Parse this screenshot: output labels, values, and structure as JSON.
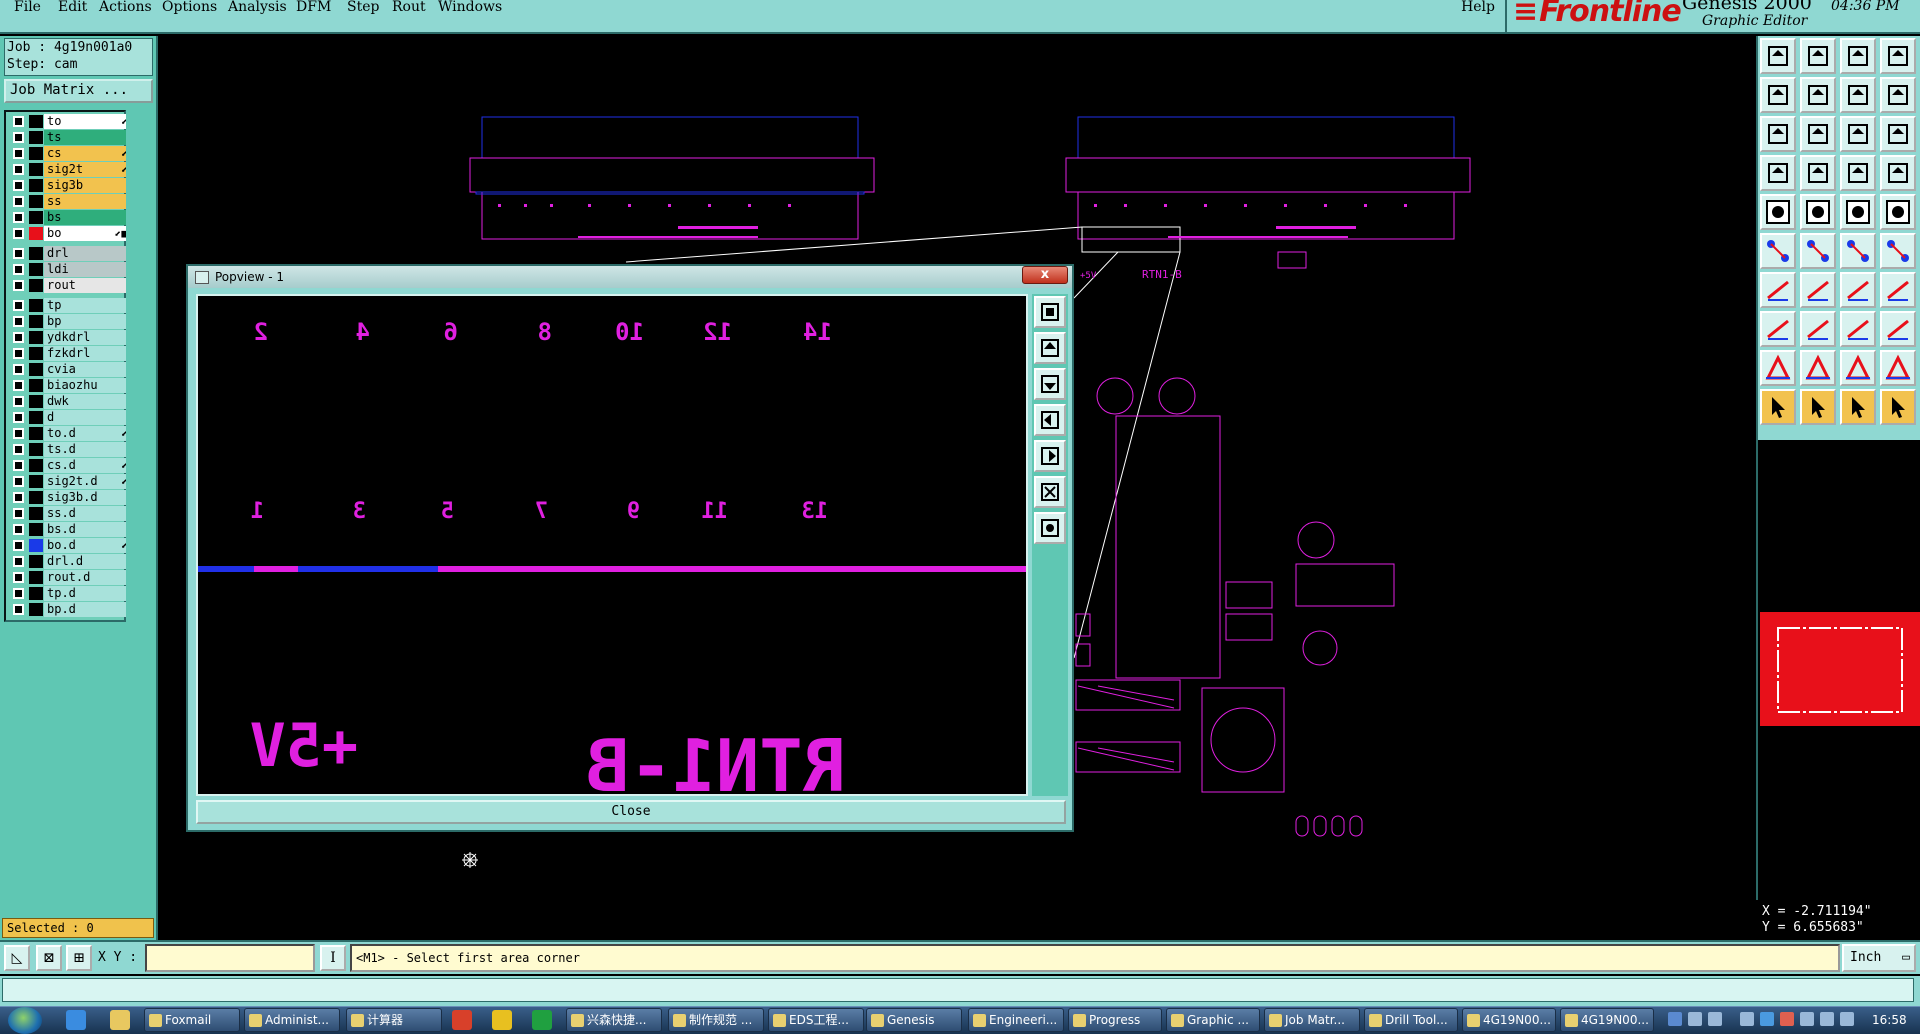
{
  "menu": {
    "items": [
      "File",
      "Edit",
      "Actions",
      "Options",
      "Analysis",
      "DFM",
      "Step",
      "Rout",
      "Windows"
    ],
    "help": "Help"
  },
  "brand": {
    "logo": "Frontline",
    "product": "Genesis 2000",
    "subtitle": "Graphic Editor",
    "time": "04:36 PM"
  },
  "job": {
    "job_line": "Job : 4g19n001a0",
    "step_line": "Step: cam",
    "matrix_button": "Job Matrix ..."
  },
  "layers": [
    {
      "name": "to",
      "color": "#ffffff",
      "marker": "⬋"
    },
    {
      "name": "ts",
      "color": "#2fae7c",
      "marker": ""
    },
    {
      "name": "cs",
      "color": "#f2c24e",
      "marker": "⬋"
    },
    {
      "name": "sig2t",
      "color": "#f2c24e",
      "marker": "⬋"
    },
    {
      "name": "sig3b",
      "color": "#f2c24e",
      "marker": ""
    },
    {
      "name": "ss",
      "color": "#f2c24e",
      "marker": ""
    },
    {
      "name": "bs",
      "color": "#2fae7c",
      "marker": ""
    },
    {
      "name": "bo",
      "color": "#ffffff",
      "marker": "⬋■",
      "swatch": "#e8101a"
    },
    {
      "name": "drl",
      "color": "#b8c8c8",
      "marker": ""
    },
    {
      "name": "ldi",
      "color": "#b8c8c8",
      "marker": ""
    },
    {
      "name": "rout",
      "color": "#e6e6e6",
      "marker": ""
    },
    {
      "name": "tp",
      "color": "#a8e2db",
      "marker": ""
    },
    {
      "name": "bp",
      "color": "#a8e2db",
      "marker": ""
    },
    {
      "name": "ydkdrl",
      "color": "#a8e2db",
      "marker": ""
    },
    {
      "name": "fzkdrl",
      "color": "#a8e2db",
      "marker": ""
    },
    {
      "name": "cvia",
      "color": "#a8e2db",
      "marker": ""
    },
    {
      "name": "biaozhu",
      "color": "#a8e2db",
      "marker": ""
    },
    {
      "name": "dwk",
      "color": "#a8e2db",
      "marker": ""
    },
    {
      "name": "d",
      "color": "#a8e2db",
      "marker": ""
    },
    {
      "name": "to.d",
      "color": "#a8e2db",
      "marker": "⬋"
    },
    {
      "name": "ts.d",
      "color": "#a8e2db",
      "marker": ""
    },
    {
      "name": "cs.d",
      "color": "#a8e2db",
      "marker": "⬋"
    },
    {
      "name": "sig2t.d",
      "color": "#a8e2db",
      "marker": "⬋"
    },
    {
      "name": "sig3b.d",
      "color": "#a8e2db",
      "marker": ""
    },
    {
      "name": "ss.d",
      "color": "#a8e2db",
      "marker": ""
    },
    {
      "name": "bs.d",
      "color": "#a8e2db",
      "marker": ""
    },
    {
      "name": "bo.d",
      "color": "#a8e2db",
      "marker": "⬋",
      "swatch": "#1a3ae8"
    },
    {
      "name": "drl.d",
      "color": "#a8e2db",
      "marker": ""
    },
    {
      "name": "rout.d",
      "color": "#a8e2db",
      "marker": ""
    },
    {
      "name": "tp.d",
      "color": "#a8e2db",
      "marker": ""
    },
    {
      "name": "bp.d",
      "color": "#a8e2db",
      "marker": ""
    }
  ],
  "selected": "Selected : 0",
  "coords": {
    "x": "X = -2.711194\"",
    "y": "Y = 6.655683\""
  },
  "command": {
    "xy_label": "X Y :",
    "xy_value": "",
    "prompt": "<M1> - Select first area corner",
    "unit": "Inch"
  },
  "popview": {
    "title": "Popview - 1",
    "close_x": "x",
    "close_button": "Close",
    "mirrored_labels_top": [
      "2",
      "4",
      "6",
      "8",
      "10",
      "12",
      "14"
    ],
    "mirrored_labels_mid": [
      "1",
      "3",
      "5",
      "7",
      "9",
      "11",
      "13"
    ],
    "big_text_left": "+5V",
    "big_text_right": "RTN1-B"
  },
  "canvas_texts": {
    "rtn_label": "RTN1-B",
    "plus5_label": "+5V"
  },
  "colors": {
    "magenta": "#e020e0",
    "blue": "#2030e8",
    "panel": "#5fc7b3",
    "menubar": "#8fd8d2"
  },
  "taskbar": {
    "tasks": [
      "Foxmail",
      "Administ...",
      "计算器",
      "兴森快捷...",
      "制作规范 ...",
      "EDS工程...",
      "Genesis",
      "Engineeri...",
      "Progress",
      "Graphic ...",
      "Job Matr...",
      "Drill Tool...",
      "4G19N00...",
      "4G19N00..."
    ],
    "clock": "16:58"
  }
}
